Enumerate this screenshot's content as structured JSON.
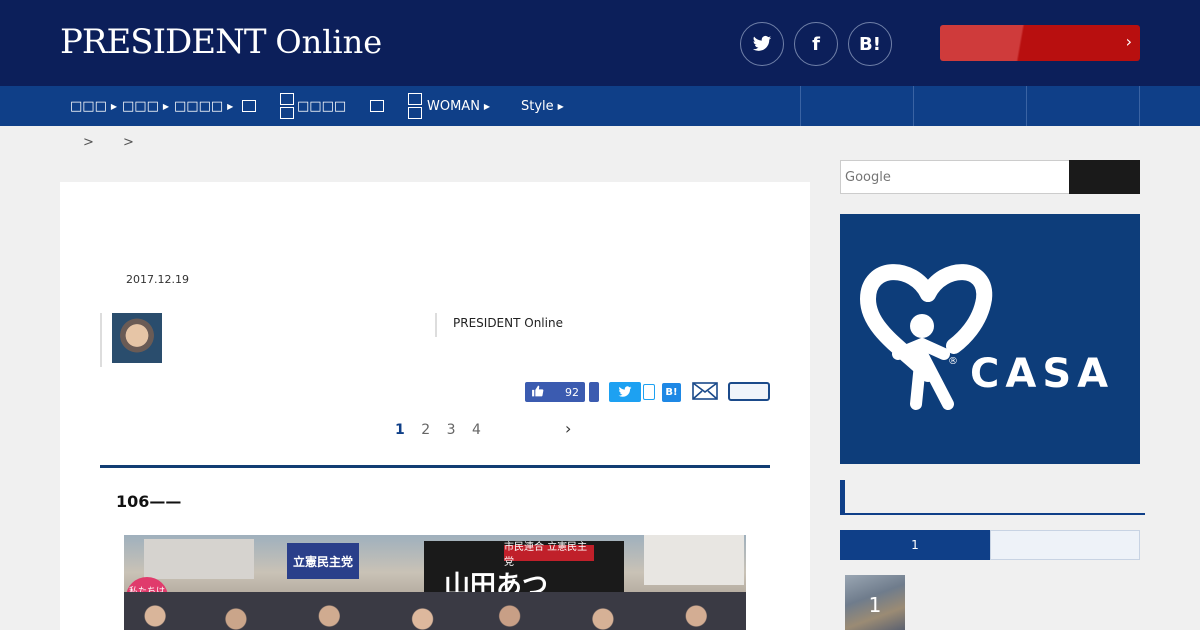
{
  "header": {
    "logo_main": "PRESIDENT",
    "logo_sub": "Online",
    "social": [
      {
        "name": "twitter",
        "glyph": "🐦"
      },
      {
        "name": "facebook",
        "glyph": "f"
      },
      {
        "name": "hatena",
        "glyph": "B!"
      }
    ],
    "cta_chevron": "›"
  },
  "nav": {
    "items": [
      {
        "label": "□□□"
      },
      {
        "label": "□□□"
      },
      {
        "label": "□□□□"
      },
      {
        "label": ""
      },
      {
        "label": "□□□□"
      },
      {
        "label": ""
      },
      {
        "label": "WOMAN"
      },
      {
        "label": "Style"
      }
    ]
  },
  "breadcrumb": {
    "sep1": ">",
    "sep2": ">"
  },
  "article": {
    "date": "2017.12.19",
    "source": "PRESIDENT Online",
    "like_count": "92",
    "hatena_label": "B!",
    "pages": [
      "1",
      "2",
      "3",
      "4"
    ],
    "next": "›",
    "section_heading": "106——",
    "photo": {
      "sign_left": "立憲民主党",
      "banner_red": "市民連合 立憲民主党",
      "banner_name": "山田あつ",
      "pink_sign": "私たちは つながる"
    }
  },
  "sidebar": {
    "search_placeholder": "Google",
    "ad": {
      "brand": "CASA",
      "reg": "®"
    },
    "tab_active": "1",
    "rank_number": "1"
  },
  "colors": {
    "header_bg": "#0c1f5a",
    "nav_bg": "#0f3f88",
    "cta_red": "#b80f0f",
    "ad_bg": "#0d3d7a"
  }
}
